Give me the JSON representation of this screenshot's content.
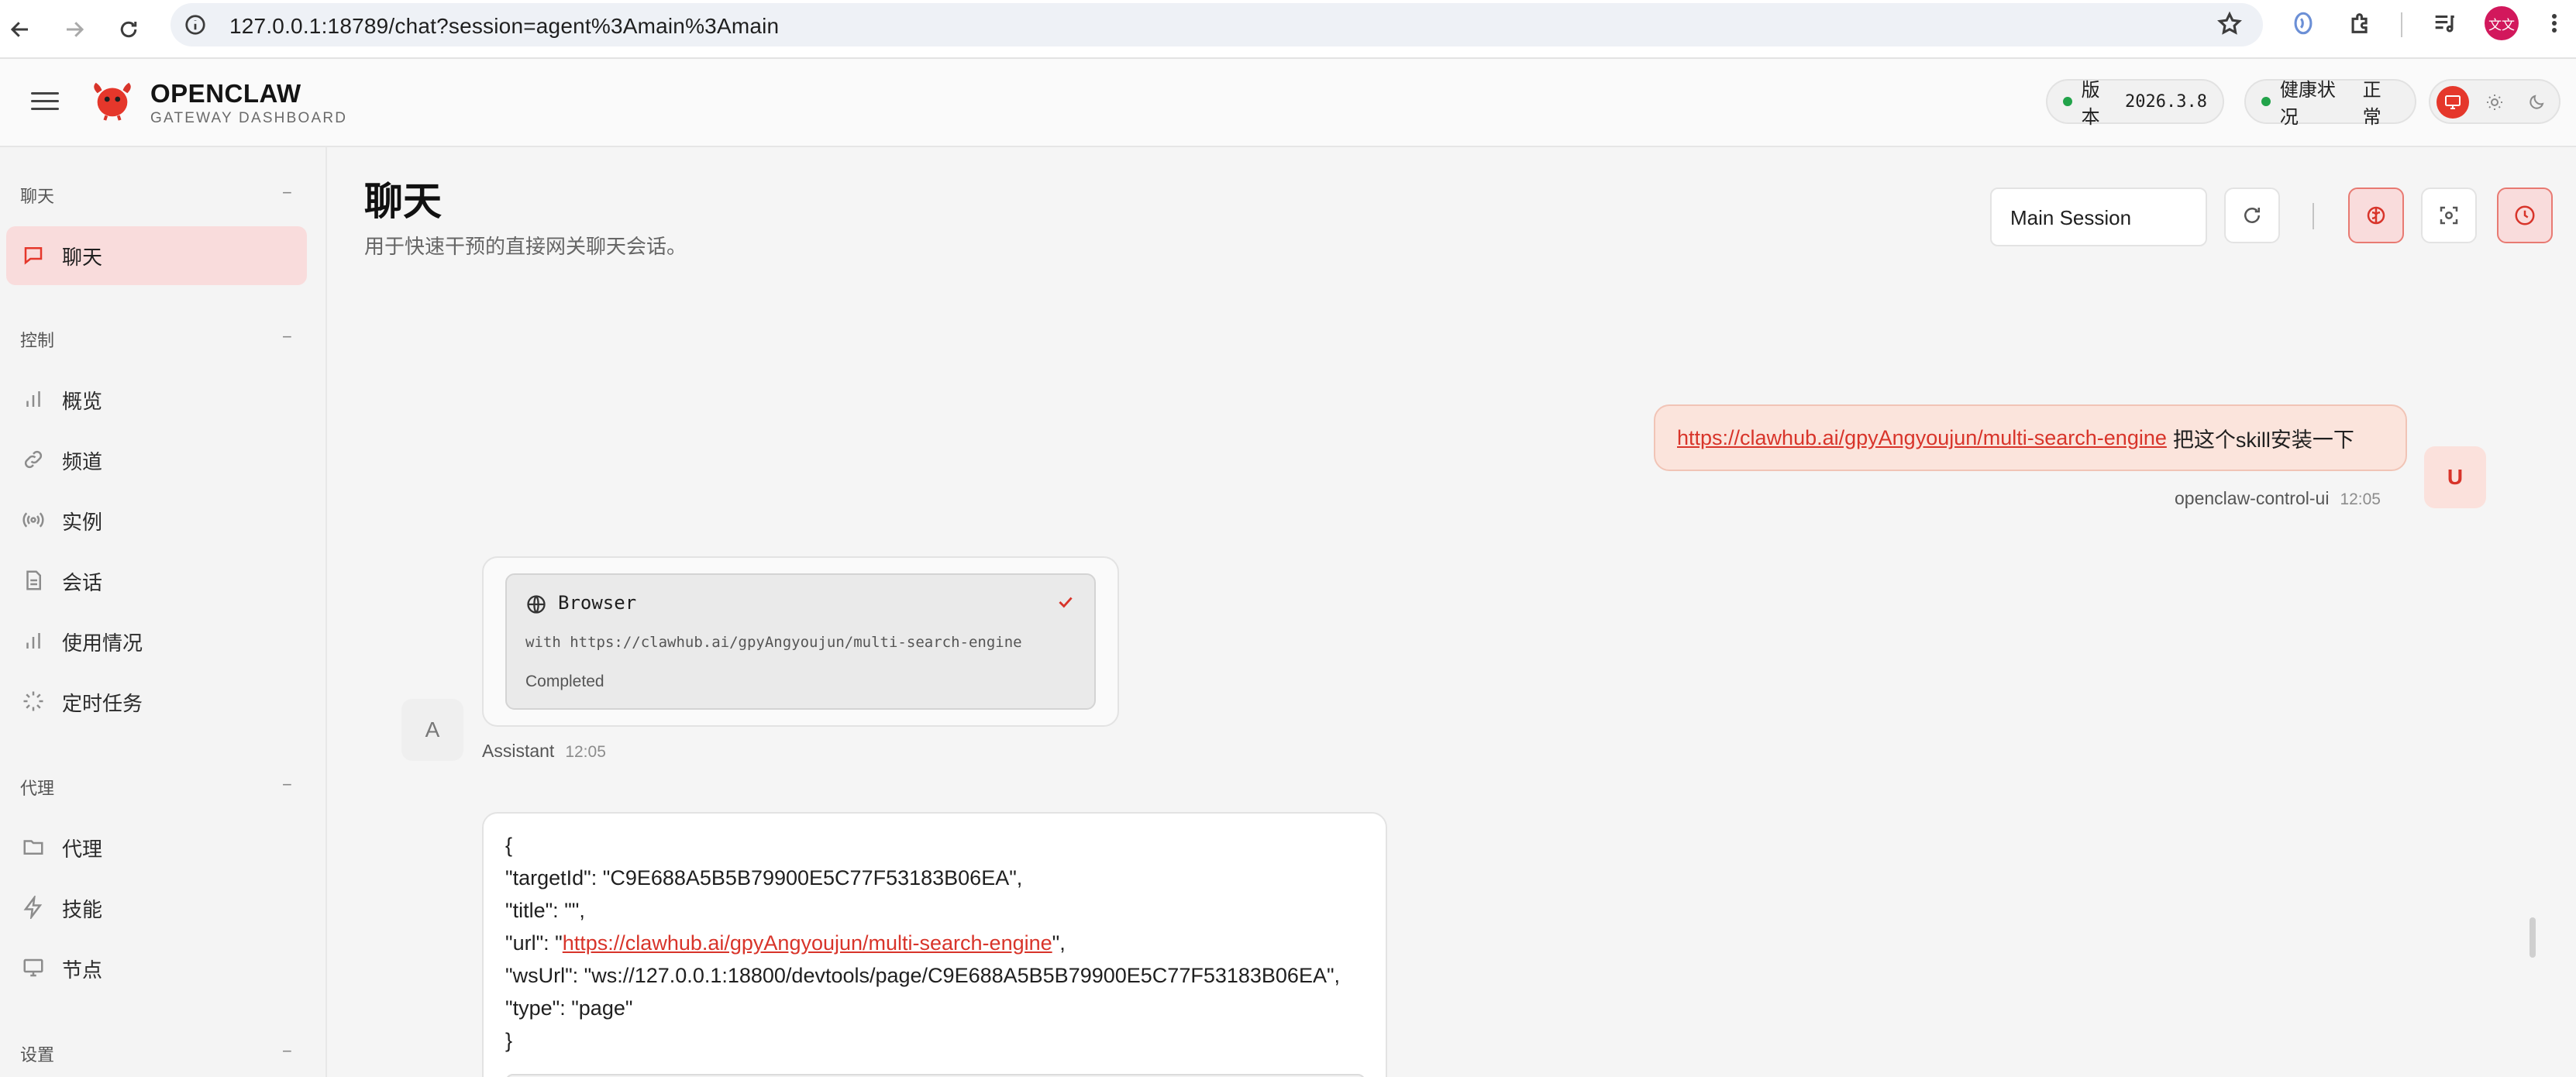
{
  "browser": {
    "url": "127.0.0.1:18789/chat?session=agent%3Amain%3Amain",
    "profile_initials": "文文"
  },
  "header": {
    "brand_title": "OPENCLAW",
    "brand_subtitle": "GATEWAY DASHBOARD",
    "version_label": "版本",
    "version_value": "2026.3.8",
    "health_label": "健康状况",
    "health_value": "正常",
    "status_color": "#22a34a",
    "accent_color": "#e5372b"
  },
  "sidebar": {
    "sections": [
      {
        "title": "聊天",
        "toggle": "−",
        "items": [
          {
            "label": "聊天",
            "icon": "chat-bubble-icon",
            "active": true
          }
        ]
      },
      {
        "title": "控制",
        "toggle": "−",
        "items": [
          {
            "label": "概览",
            "icon": "bar-chart-icon"
          },
          {
            "label": "频道",
            "icon": "link-icon"
          },
          {
            "label": "实例",
            "icon": "radio-signal-icon"
          },
          {
            "label": "会话",
            "icon": "document-icon"
          },
          {
            "label": "使用情况",
            "icon": "bar-chart-icon"
          },
          {
            "label": "定时任务",
            "icon": "spinner-icon"
          }
        ]
      },
      {
        "title": "代理",
        "toggle": "−",
        "items": [
          {
            "label": "代理",
            "icon": "folder-icon"
          },
          {
            "label": "技能",
            "icon": "lightning-icon"
          },
          {
            "label": "节点",
            "icon": "monitor-icon"
          }
        ]
      },
      {
        "title": "设置",
        "toggle": "−",
        "items": []
      }
    ]
  },
  "main": {
    "title": "聊天",
    "subtitle": "用于快速干预的直接网关聊天会话。",
    "session_select": "Main Session",
    "separator": "|"
  },
  "chat": {
    "user_message": {
      "link": "https://clawhub.ai/gpyAngyoujun/multi-search-engine",
      "text": "把这个skill安装一下",
      "sender": "openclaw-control-ui",
      "time": "12:05",
      "avatar": "U"
    },
    "assistant_tool": {
      "tool_name": "Browser",
      "detail": "with https://clawhub.ai/gpyAngyoujun/multi-search-engine",
      "status": "Completed",
      "sender": "Assistant",
      "time": "12:05",
      "avatar": "A"
    },
    "json_output": {
      "open": "{",
      "target_key": "\"targetId\": ",
      "target_val": "\"C9E688A5B5B79900E5C77F53183B06EA\",",
      "title_line": "\"title\": \"\",",
      "url_key": "\"url\": \"",
      "url_val": "https://clawhub.ai/gpyAngyoujun/multi-search-engine",
      "url_end": "\",",
      "ws_line": "\"wsUrl\": \"ws://127.0.0.1:18800/devtools/page/C9E688A5B5B79900E5C77F53183B06EA\",",
      "type_line": "\"type\": \"page\"",
      "close": "}"
    }
  }
}
